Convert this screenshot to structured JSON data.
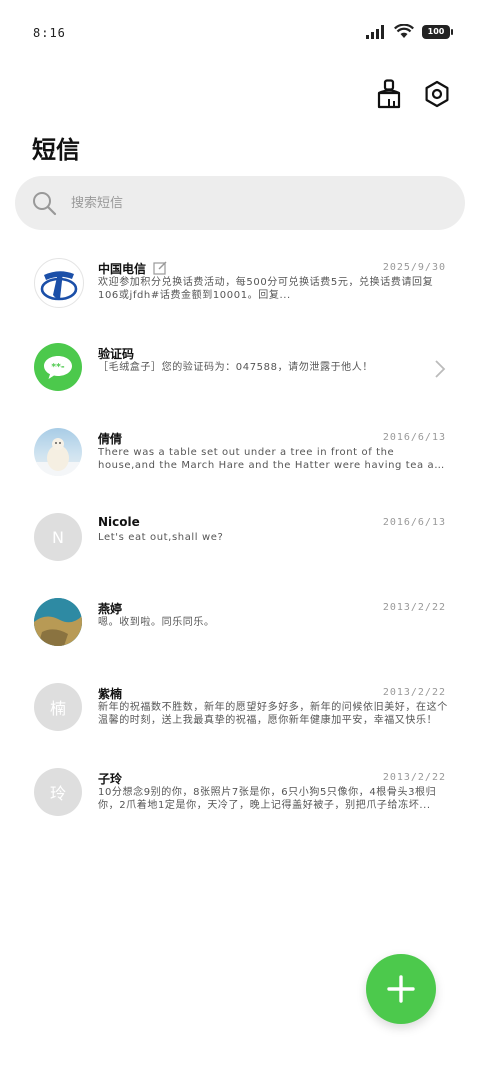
{
  "status_bar": {
    "time": "8:16",
    "battery": "100"
  },
  "header": {
    "title": "短信",
    "clean_icon": "broom-icon",
    "settings_icon": "gear-icon"
  },
  "search": {
    "placeholder": "搜索短信",
    "icon": "search-icon"
  },
  "messages": [
    {
      "name": "中国电信",
      "date": "2025/9/30",
      "preview": "欢迎参加积分兑换话费活动，每500分可兑换话费5元，兑换话费请回复106或jfdh#话费金额到10001。回复...",
      "avatar_type": "telecom-logo"
    },
    {
      "name": "验证码",
      "date": "",
      "preview": "［毛绒盒子］您的验证码为：047588，请勿泄露于他人！",
      "avatar_type": "chat-bubble",
      "avatar_color": "#4cc94c"
    },
    {
      "name": "倩倩",
      "date": "2016/6/13",
      "preview": "There was a table set out under a tree in front of the house,and the March Hare and the Hatter were having tea at it.",
      "avatar_type": "photo-polar-bear"
    },
    {
      "name": "Nicole",
      "date": "2016/6/13",
      "preview": "Let's eat out,shall we?",
      "avatar_letter": "N",
      "avatar_color": "#dedede"
    },
    {
      "name": "燕婷",
      "date": "2013/2/22",
      "preview": "嗯。收到啦。同乐同乐。",
      "avatar_type": "photo-sea-rock"
    },
    {
      "name": "紫楠",
      "date": "2013/2/22",
      "preview": "新年的祝福数不胜数，新年的愿望好多好多，新年的问候依旧美好，在这个温馨的时刻，送上我最真挚的祝福，愿你新年健康加平安，幸福又快乐！",
      "avatar_letter": "楠",
      "avatar_color": "#dedede"
    },
    {
      "name": "子玲",
      "date": "2013/2/22",
      "preview": "10分想念9别的你，8张照片7张是你，6只小狗5只像你，4根骨头3根归你，2爪着地1定是你，天冷了，晚上记得盖好被子，别把爪子给冻坏...",
      "avatar_letter": "玲",
      "avatar_color": "#dedede"
    }
  ],
  "fab": {
    "icon": "plus-icon",
    "color": "#4cc94c"
  }
}
